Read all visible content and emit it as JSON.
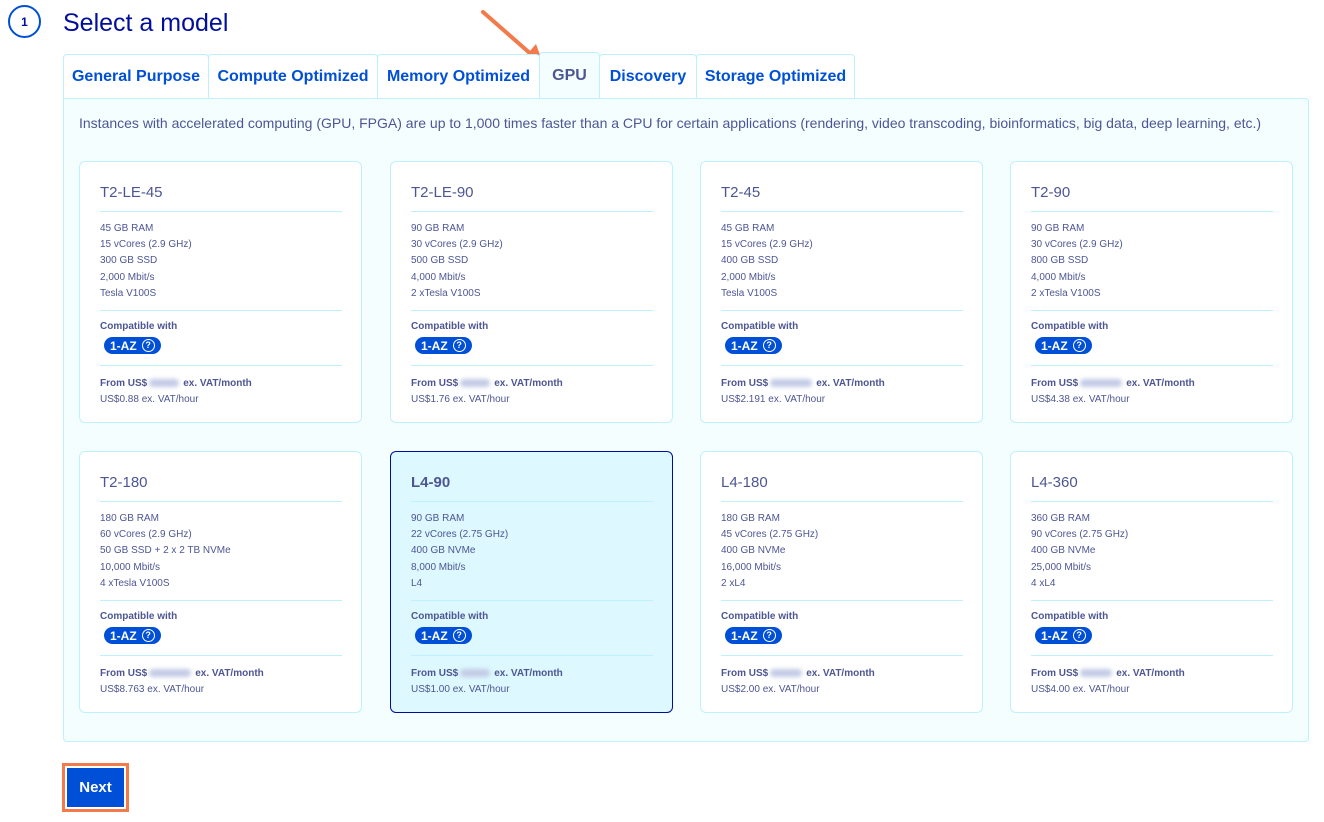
{
  "step": {
    "number": "1",
    "title": "Select a model"
  },
  "tabs": [
    {
      "label": "General Purpose"
    },
    {
      "label": "Compute Optimized"
    },
    {
      "label": "Memory Optimized"
    },
    {
      "label": "GPU"
    },
    {
      "label": "Discovery"
    },
    {
      "label": "Storage Optimized"
    }
  ],
  "active_tab": "GPU",
  "description": "Instances with accelerated computing (GPU, FPGA) are up to 1,000 times faster than a CPU for certain applications (rendering, video transcoding, bioinformatics, big data, deep learning, etc.)",
  "compat_label": "Compatible with",
  "compat_badge": "1-AZ",
  "price_prefix": "From US$",
  "price_suffix": "ex. VAT/month",
  "models": [
    {
      "name": "T2-LE-45",
      "selected": false,
      "specs": [
        "45 GB RAM",
        "15 vCores (2.9 GHz)",
        "300 GB SSD",
        "2,000 Mbit/s",
        "Tesla V100S"
      ],
      "hourly": "US$0.88 ex. VAT/hour"
    },
    {
      "name": "T2-LE-90",
      "selected": false,
      "specs": [
        "90 GB RAM",
        "30 vCores (2.9 GHz)",
        "500 GB SSD",
        "4,000 Mbit/s",
        "2 xTesla V100S"
      ],
      "hourly": "US$1.76 ex. VAT/hour"
    },
    {
      "name": "T2-45",
      "selected": false,
      "specs": [
        "45 GB RAM",
        "15 vCores (2.9 GHz)",
        "400 GB SSD",
        "2,000 Mbit/s",
        "Tesla V100S"
      ],
      "hourly": "US$2.191 ex. VAT/hour"
    },
    {
      "name": "T2-90",
      "selected": false,
      "specs": [
        "90 GB RAM",
        "30 vCores (2.9 GHz)",
        "800 GB SSD",
        "4,000 Mbit/s",
        "2 xTesla V100S"
      ],
      "hourly": "US$4.38 ex. VAT/hour"
    },
    {
      "name": "T2-180",
      "selected": false,
      "specs": [
        "180 GB RAM",
        "60 vCores (2.9 GHz)",
        "50 GB SSD + 2 x 2 TB NVMe",
        "10,000 Mbit/s",
        "4 xTesla V100S"
      ],
      "hourly": "US$8.763 ex. VAT/hour"
    },
    {
      "name": "L4-90",
      "selected": true,
      "specs": [
        "90 GB RAM",
        "22 vCores (2.75 GHz)",
        "400 GB NVMe",
        "8,000 Mbit/s",
        "L4"
      ],
      "hourly": "US$1.00 ex. VAT/hour"
    },
    {
      "name": "L4-180",
      "selected": false,
      "specs": [
        "180 GB RAM",
        "45 vCores (2.75 GHz)",
        "400 GB NVMe",
        "16,000 Mbit/s",
        "2 xL4"
      ],
      "hourly": "US$2.00 ex. VAT/hour"
    },
    {
      "name": "L4-360",
      "selected": false,
      "specs": [
        "360 GB RAM",
        "90 vCores (2.75 GHz)",
        "400 GB NVMe",
        "25,000 Mbit/s",
        "4 xL4"
      ],
      "hourly": "US$4.00 ex. VAT/hour"
    }
  ],
  "next_label": "Next",
  "colors": {
    "primary": "#0050d7",
    "navy": "#000e9c",
    "text": "#4d5693",
    "border": "#bef1ff",
    "panel_bg": "#f5feff",
    "selected_bg": "#ddf8ff",
    "annotation": "#f27a4b"
  }
}
